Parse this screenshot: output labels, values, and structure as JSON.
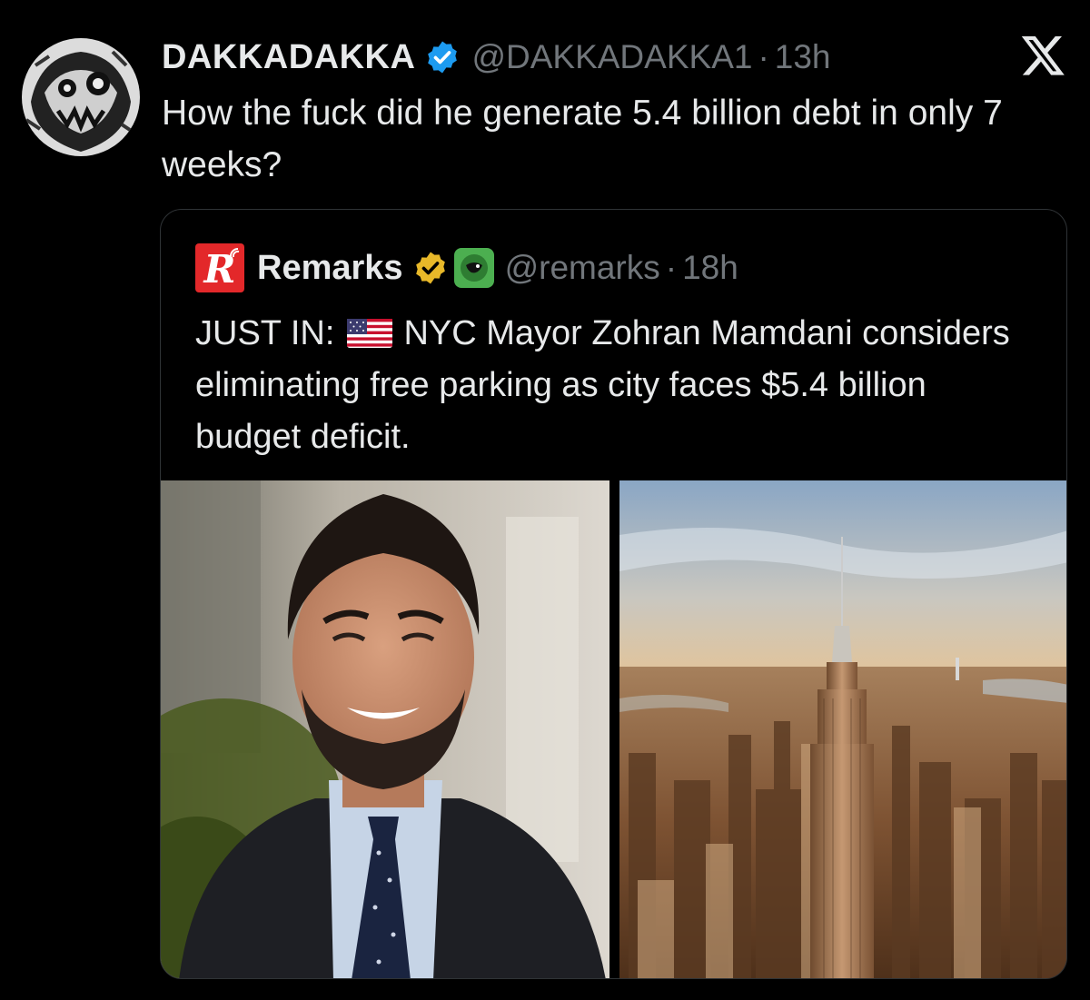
{
  "post": {
    "author_name": "DAKKADAKKA",
    "author_handle": "@DAKKADAKKA1",
    "separator": "·",
    "time": "13h",
    "text": "How the fuck did he generate 5.4 billion debt in only 7 weeks?",
    "verified_badge_icon": "blue-verified-check-icon",
    "brand_icon": "x-logo-icon",
    "colors": {
      "verified": "#1d9bf0",
      "muted": "#71767b",
      "text": "#e7e9ea",
      "background": "#000000"
    }
  },
  "quote": {
    "logo_letter": "R",
    "author_name": "Remarks",
    "author_handle": "@remarks",
    "separator": "·",
    "time": "18h",
    "text_prefix": "JUST IN:",
    "flag_icon": "us-flag-icon",
    "text_body": "NYC Mayor Zohran Mamdani considers eliminating free parking as city faces $5.4 billion budget deficit.",
    "badges": [
      "gold-verified-check-icon",
      "affiliate-badge-icon"
    ],
    "colors": {
      "logo": "#e3282a",
      "gold_badge": "#e8b829",
      "affiliate": "#4caf50"
    },
    "media": [
      "portrait-photo",
      "city-skyline-photo"
    ]
  }
}
